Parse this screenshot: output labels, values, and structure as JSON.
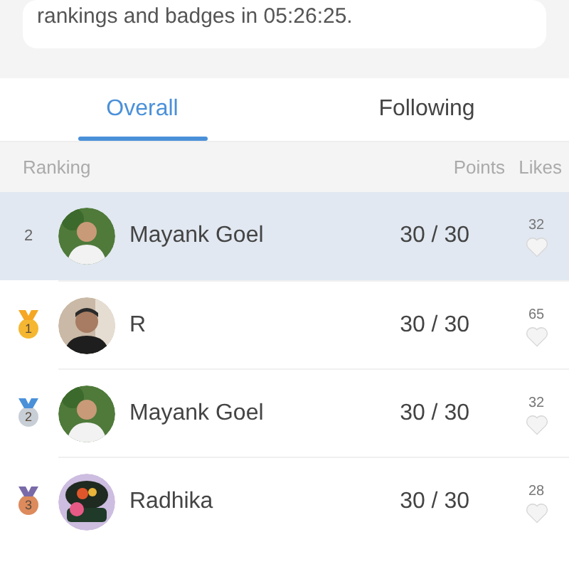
{
  "notice": {
    "text": "rankings and badges in 05:26:25."
  },
  "tabs": [
    {
      "label": "Overall",
      "selected": true
    },
    {
      "label": "Following",
      "selected": false
    }
  ],
  "columns": {
    "ranking": "Ranking",
    "points": "Points",
    "likes": "Likes"
  },
  "rows": [
    {
      "rank": "2",
      "kind": "plain",
      "name": "Mayank Goel",
      "points": "30 / 30",
      "likes": "32",
      "selected": true
    },
    {
      "rank": "1",
      "kind": "medal",
      "color": "#f5b731",
      "name": "R",
      "points": "30 / 30",
      "likes": "65",
      "selected": false
    },
    {
      "rank": "2",
      "kind": "medal",
      "color": "#c8ced6",
      "name": "Mayank Goel",
      "points": "30 / 30",
      "likes": "32",
      "selected": false
    },
    {
      "rank": "3",
      "kind": "medal",
      "color": "#dd8a5c",
      "name": "Radhika",
      "points": "30 / 30",
      "likes": "28",
      "selected": false
    }
  ]
}
